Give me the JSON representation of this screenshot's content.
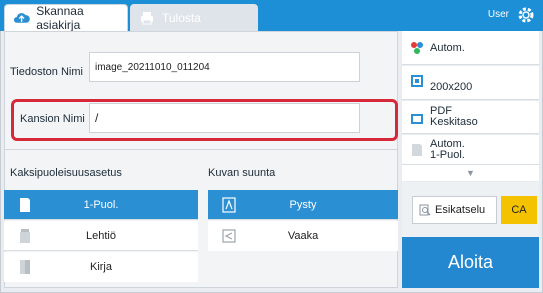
{
  "tabs": [
    {
      "label": "Skannaa asiakirja",
      "icon": "scan-cloud-icon",
      "active": true
    },
    {
      "label": "Tulosta",
      "icon": "printer-icon",
      "active": false
    }
  ],
  "header": {
    "user": "User",
    "gear_icon": "gear-icon"
  },
  "form": {
    "file_name_label": "Tiedoston Nimi",
    "file_name_value": "image_20211010_011204",
    "folder_name_label": "Kansion Nimi",
    "folder_name_value": "/"
  },
  "duplex": {
    "title": "Kaksipuoleisuusasetus",
    "options": [
      {
        "label": "1-Puol.",
        "selected": true,
        "icon": "one-sided-icon"
      },
      {
        "label": "Lehtiö",
        "selected": false,
        "icon": "tablet-icon"
      },
      {
        "label": "Kirja",
        "selected": false,
        "icon": "book-icon"
      }
    ]
  },
  "orientation": {
    "title": "Kuvan suunta",
    "options": [
      {
        "label": "Pysty",
        "selected": true,
        "icon": "portrait-icon"
      },
      {
        "label": "Vaaka",
        "selected": false,
        "icon": "landscape-icon"
      }
    ]
  },
  "settings": {
    "color": "Autom.",
    "resolution": "200x200",
    "format_line1": "PDF",
    "format_line2": "Keskitaso",
    "size_line1": "Autom.",
    "size_line2": "1-Puol."
  },
  "actions": {
    "preview": "Esikatselu",
    "ca": "CA",
    "start": "Aloita"
  },
  "colors": {
    "accent": "#2b8fd3",
    "highlight": "#d62839",
    "ca": "#f5c200"
  }
}
